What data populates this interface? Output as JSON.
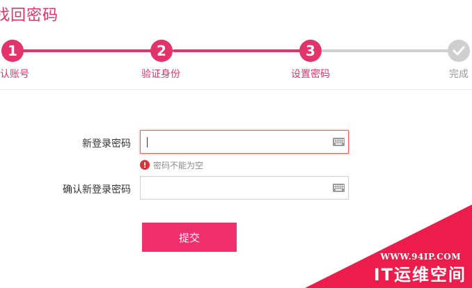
{
  "page": {
    "title": "找回密码"
  },
  "steps": [
    {
      "number": "1",
      "label": "确认账号",
      "state": "done"
    },
    {
      "number": "2",
      "label": "验证身份",
      "state": "done"
    },
    {
      "number": "3",
      "label": "设置密码",
      "state": "current"
    },
    {
      "number": "",
      "label": "完成",
      "state": "pending",
      "icon": "check-icon"
    }
  ],
  "colors": {
    "accent": "#e2336b",
    "button": "#f0306d",
    "inactive": "#cfcfcf",
    "error": "#e0303a"
  },
  "form": {
    "new_password_label": "新登录密码",
    "new_password_value": "",
    "error_message": "密码不能为空",
    "confirm_password_label": "确认新登录密码",
    "confirm_password_value": "",
    "submit_label": "提交",
    "keyboard_icon": "keyboard-icon"
  },
  "watermark": {
    "url": "WWW.94IP.COM",
    "text": "IT运维空间"
  }
}
